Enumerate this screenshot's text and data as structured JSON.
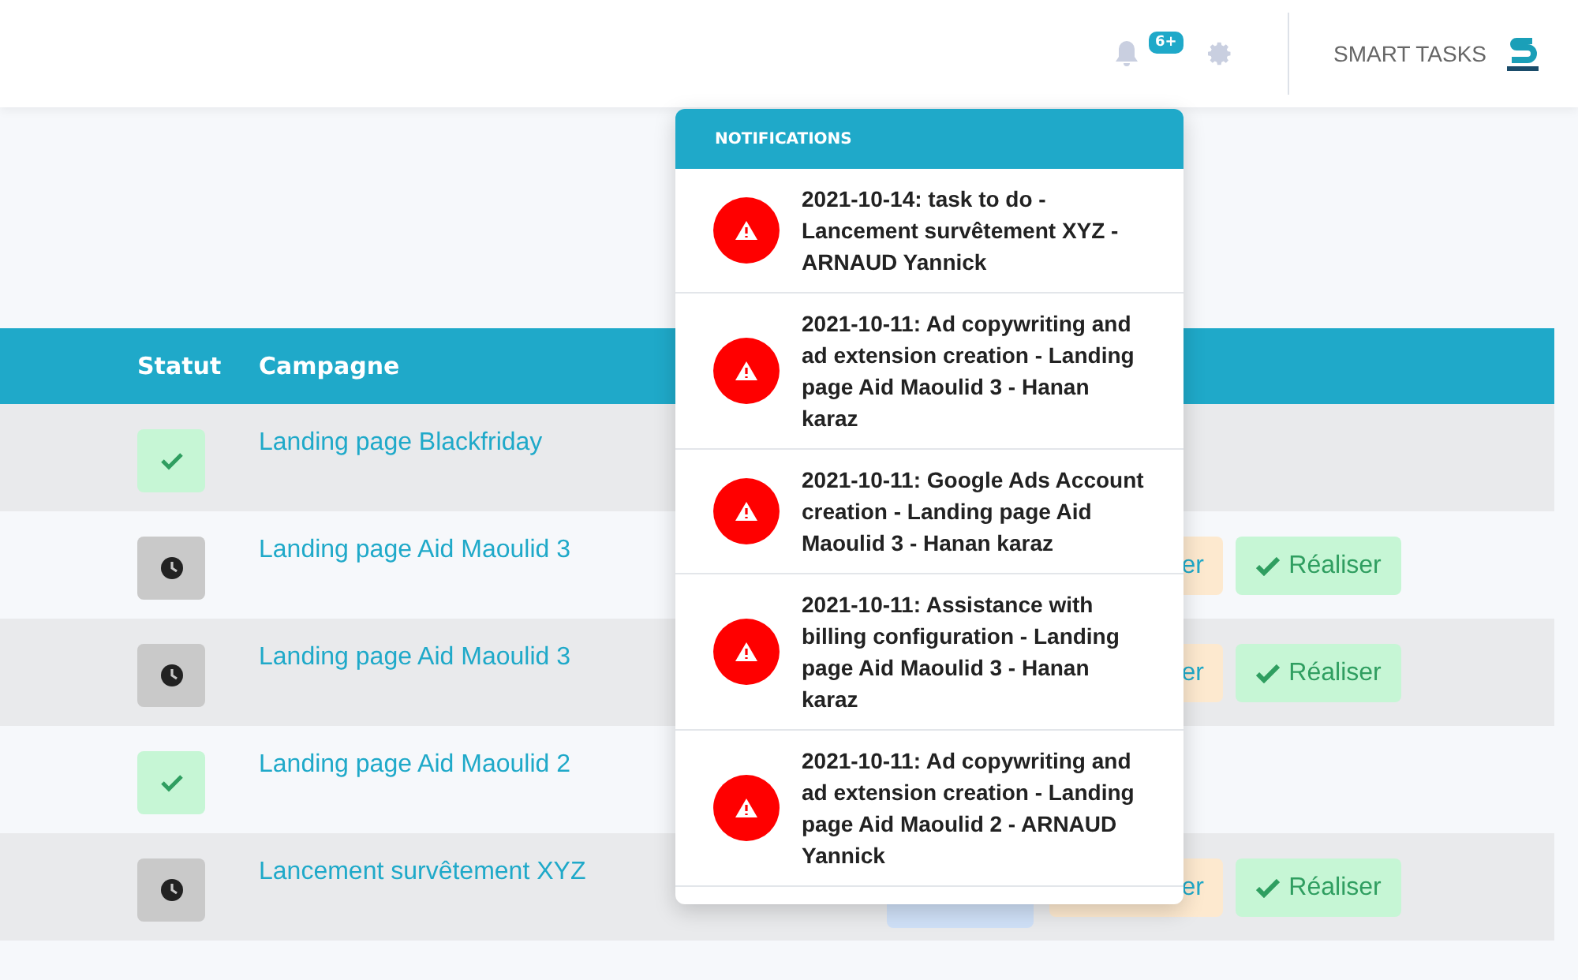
{
  "header": {
    "notification_count": "6+",
    "brand": "SMART TASKS"
  },
  "table": {
    "columns": [
      "Statut",
      "Campagne"
    ],
    "rows": [
      {
        "done": true,
        "campagne": "Landing page Blackfriday",
        "actions": []
      },
      {
        "done": false,
        "campagne": "Landing page Aid Maoulid 3",
        "actions": [
          {
            "kind": "plan",
            "label": "er"
          },
          {
            "kind": "done",
            "label": "Réaliser"
          }
        ]
      },
      {
        "done": false,
        "campagne": "Landing page Aid Maoulid 3",
        "actions": [
          {
            "kind": "plan",
            "label": "er"
          },
          {
            "kind": "done",
            "label": "Réaliser"
          }
        ]
      },
      {
        "done": true,
        "campagne": "Landing page Aid Maoulid 2",
        "actions": []
      },
      {
        "done": false,
        "campagne": "Lancement survêtement XYZ",
        "actions": [
          {
            "kind": "edit"
          },
          {
            "kind": "plan",
            "label": "er"
          },
          {
            "kind": "done",
            "label": "Réaliser"
          }
        ]
      }
    ]
  },
  "notifications": {
    "title": "NOTIFICATIONS",
    "items": [
      {
        "text": "2021-10-14: task to do - Lancement survêtement XYZ - ARNAUD Yannick"
      },
      {
        "text": "2021-10-11: Ad copywriting and ad extension creation - Landing page Aid Maoulid 3 - Hanan karaz"
      },
      {
        "text": "2021-10-11: Google Ads Account creation - Landing page Aid Maoulid 3 - Hanan karaz"
      },
      {
        "text": "2021-10-11: Assistance with billing configuration - Landing page Aid Maoulid 3 - Hanan karaz"
      },
      {
        "text": "2021-10-11: Ad copywriting and ad extension creation - Landing page Aid Maoulid 2 - ARNAUD Yannick"
      }
    ]
  }
}
